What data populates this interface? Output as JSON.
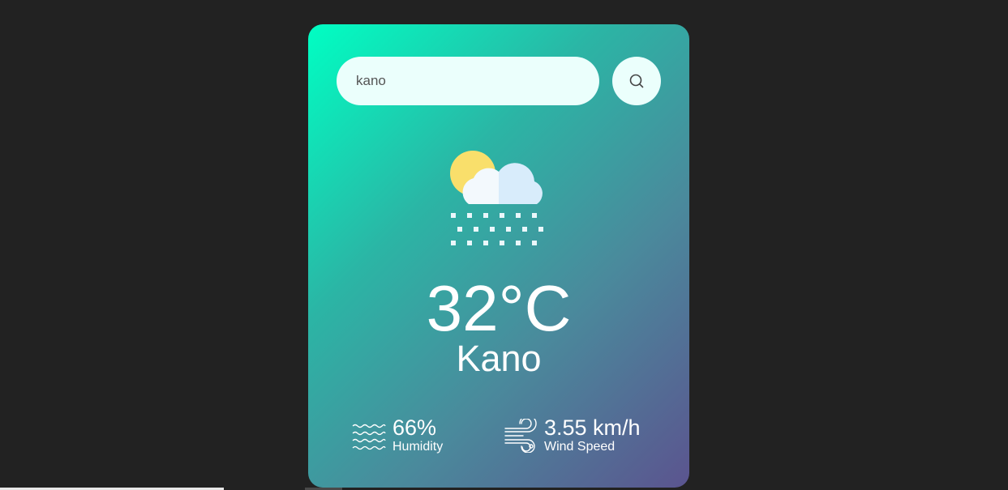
{
  "search": {
    "value": "kano",
    "placeholder": ""
  },
  "icons": {
    "search": "search-icon",
    "weather": "snow-cloud-sun-icon",
    "humidity": "humidity-waves-icon",
    "wind": "wind-icon"
  },
  "weather": {
    "temperature": "32°C",
    "city": "Kano"
  },
  "details": {
    "humidity_value": "66%",
    "humidity_label": "Humidity",
    "wind_value": "3.55 km/h",
    "wind_label": "Wind Speed"
  },
  "colors": {
    "page_background": "#222222",
    "gradient_start": "#00ffc3",
    "gradient_end": "#5b548f",
    "input_background": "#ebfffc",
    "text": "#ffffff"
  }
}
